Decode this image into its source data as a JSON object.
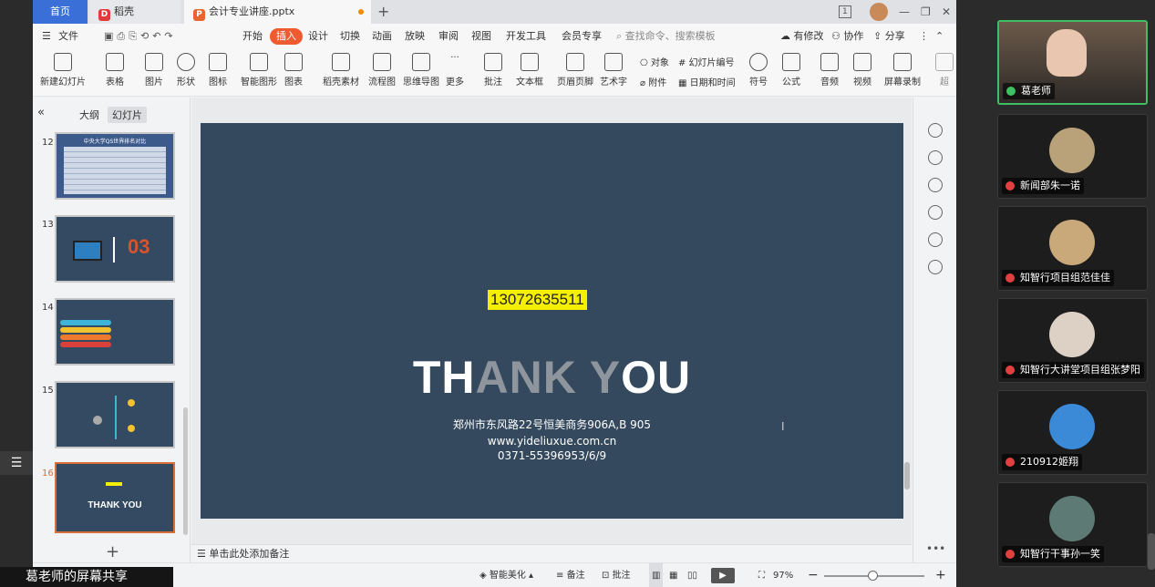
{
  "tabs": {
    "home": "首页",
    "daoke": "稻壳",
    "file": "会计专业讲座.pptx"
  },
  "window": {
    "badge": "1"
  },
  "menu": [
    "文件",
    "开始",
    "插入",
    "设计",
    "切换",
    "动画",
    "放映",
    "审阅",
    "视图",
    "开发工具",
    "会员专享"
  ],
  "menu_search": "查找命令、搜索模板",
  "menu_right": {
    "revise": "有修改",
    "collab": "协作",
    "share": "分享"
  },
  "ribbon": [
    "新建幻灯片",
    "表格",
    "图片",
    "形状",
    "图标",
    "智能图形",
    "图表",
    "稻壳素材",
    "流程图",
    "思维导图",
    "更多",
    "批注",
    "文本框",
    "页眉页脚",
    "艺术字",
    "符号",
    "公式",
    "音频",
    "视频",
    "屏幕录制",
    "超"
  ],
  "ribbon_small": {
    "object": "对象",
    "slide_num": "幻灯片编号",
    "attach": "附件",
    "datetime": "日期和时间"
  },
  "panel": {
    "outline": "大纲",
    "slides": "幻灯片"
  },
  "slide_numbers": [
    "12",
    "13",
    "14",
    "15",
    "16"
  ],
  "thumb12_title": "中央大学QS世界排名对比",
  "thumb16_text": "THANK YOU",
  "slide": {
    "phone": "13072635511",
    "thanks_a": "TH",
    "thanks_b": "ANK Y",
    "thanks_c": "OU",
    "address": "郑州市东风路22号恒美商务906A,B 905",
    "website": "www.yideliuxue.com.cn",
    "tel": "0371-55396953/6/9"
  },
  "notes": "单击此处添加备注",
  "status": {
    "beautify": "智能美化",
    "notes": "备注",
    "comment": "批注",
    "zoom": "97%"
  },
  "share_label": "葛老师的屏幕共享",
  "participants": [
    "葛老师",
    "新闻部朱一诺",
    "知智行项目组范佳佳",
    "知智行大讲堂项目组张梦阳",
    "210912姬翔",
    "知智行干事孙一笑"
  ],
  "colors": {
    "accent": "#ef5a30",
    "slide_bg": "#34495e",
    "highlight": "#f5f000",
    "active_border": "#3fbf62"
  }
}
